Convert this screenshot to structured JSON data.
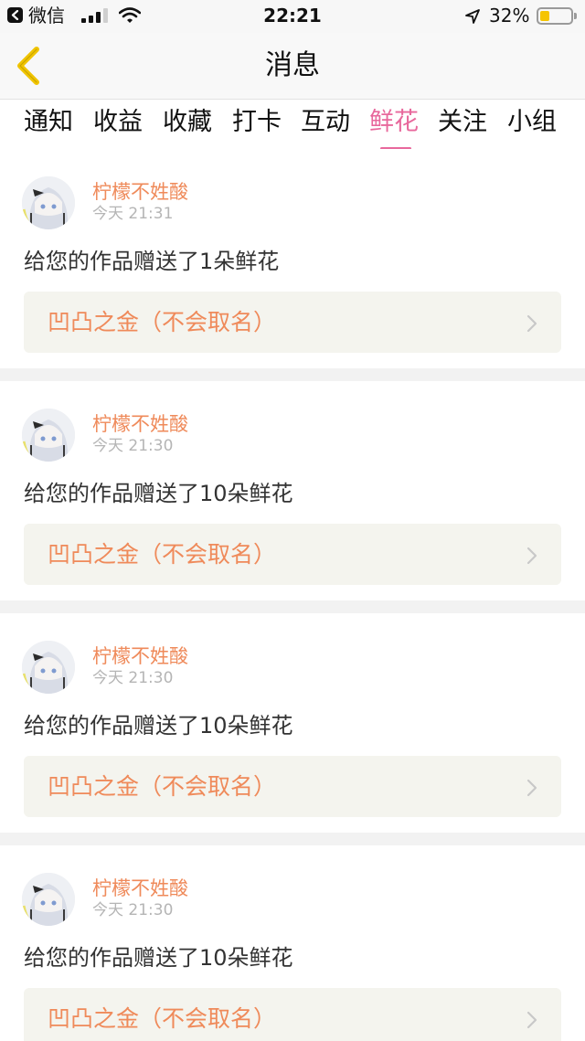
{
  "status_bar": {
    "carrier": "微信",
    "time": "22:21",
    "battery_percent": "32%",
    "battery_level": 0.32,
    "battery_color": "#f5c400"
  },
  "header": {
    "title": "消息",
    "back_icon": "chevron-left-icon",
    "accent_color": "#f0c400"
  },
  "tabs": [
    {
      "label": "通知",
      "active": false
    },
    {
      "label": "收益",
      "active": false
    },
    {
      "label": "收藏",
      "active": false
    },
    {
      "label": "打卡",
      "active": false
    },
    {
      "label": "互动",
      "active": false
    },
    {
      "label": "鲜花",
      "active": true
    },
    {
      "label": "关注",
      "active": false
    },
    {
      "label": "小组",
      "active": false
    }
  ],
  "active_tab_color": "#e8689c",
  "messages": [
    {
      "sender": "柠檬不姓酸",
      "time": "今天 21:31",
      "text": "给您的作品赠送了1朵鲜花",
      "work": "凹凸之金（不会取名）"
    },
    {
      "sender": "柠檬不姓酸",
      "time": "今天 21:30",
      "text": "给您的作品赠送了10朵鲜花",
      "work": "凹凸之金（不会取名）"
    },
    {
      "sender": "柠檬不姓酸",
      "time": "今天 21:30",
      "text": "给您的作品赠送了10朵鲜花",
      "work": "凹凸之金（不会取名）"
    },
    {
      "sender": "柠檬不姓酸",
      "time": "今天 21:30",
      "text": "给您的作品赠送了10朵鲜花",
      "work": "凹凸之金（不会取名）"
    }
  ],
  "sender_color": "#ef8a5a"
}
